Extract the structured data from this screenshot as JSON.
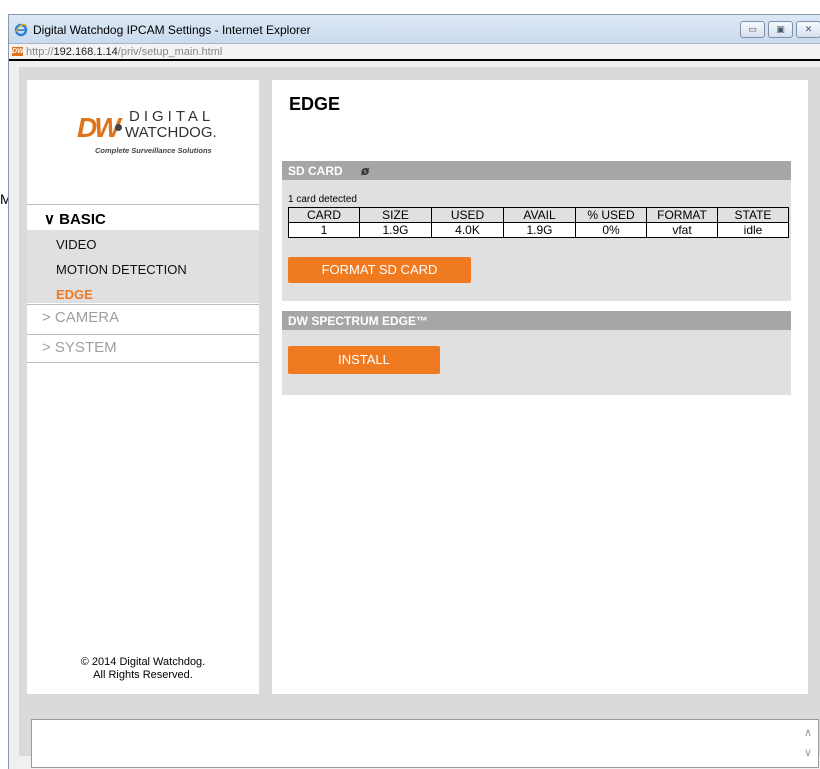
{
  "stray_text": "M",
  "window": {
    "title": "Digital Watchdog IPCAM Settings - Internet Explorer",
    "url_prefix": "http://",
    "url_host": "192.168.1.14",
    "url_path": "/priv/setup_main.html",
    "buttons": {
      "minimize": "▭",
      "maximize": "▣",
      "close": "✕"
    }
  },
  "logo": {
    "mark": "DW",
    "line1": "DIGITAL",
    "line2": "WATCHDOG.",
    "tagline": "Complete Surveillance Solutions"
  },
  "sidebar": {
    "basic_label": "∨ BASIC",
    "sub_items": [
      "VIDEO",
      "MOTION DETECTION",
      "EDGE"
    ],
    "camera_label": "> CAMERA",
    "system_label": "> SYSTEM",
    "copyright_line1": "© 2014 Digital Watchdog.",
    "copyright_line2": "All Rights Reserved."
  },
  "main": {
    "title": "EDGE",
    "sd_card": {
      "header": "SD CARD",
      "refresh_icon": "ø",
      "status": "1 card detected",
      "columns": [
        "CARD",
        "SIZE",
        "USED",
        "AVAIL",
        "% USED",
        "FORMAT",
        "STATE"
      ],
      "rows": [
        [
          "1",
          "1.9G",
          "4.0K",
          "1.9G",
          "0%",
          "vfat",
          "idle"
        ]
      ],
      "format_button": "FORMAT SD CARD"
    },
    "spectrum": {
      "header": "DW SPECTRUM EDGE™",
      "install_button": "INSTALL"
    }
  },
  "colors": {
    "accent": "#f07a20",
    "panel_header": "#a6a6a6",
    "panel_body": "#e0e0e0"
  },
  "message_box": {
    "scroll_up": "∧",
    "scroll_down": "∨"
  }
}
